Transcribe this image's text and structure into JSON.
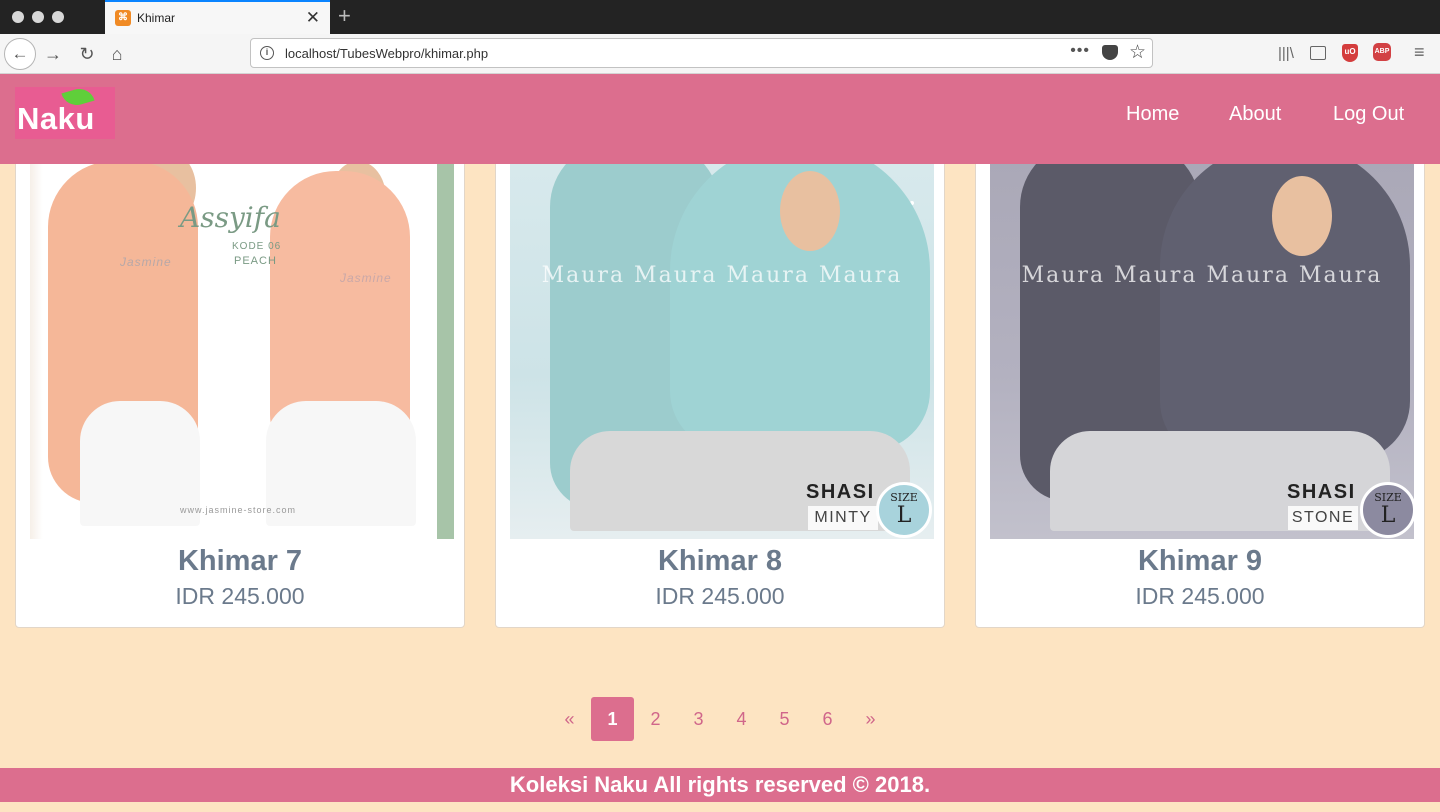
{
  "browser": {
    "tab_title": "Khimar",
    "new_tab": "+",
    "url": "localhost/TubesWebpro/khimar.php",
    "icons": [
      "back-icon",
      "forward-icon",
      "reload-icon",
      "home-icon",
      "info-icon",
      "more-icon",
      "pocket-icon",
      "bookmark-star-icon",
      "library-icon",
      "sidebar-icon",
      "ublock-icon",
      "adblock-icon",
      "menu-icon"
    ],
    "extension_labels": {
      "ublock": "uO",
      "abp": "ABP"
    }
  },
  "site": {
    "logo": "Naku",
    "accent": "#dc6e8e",
    "background": "#fde4c2",
    "nav": [
      "Home",
      "About",
      "Log Out"
    ]
  },
  "products": [
    {
      "name": "Khimar 7",
      "price": "IDR 245.000",
      "image": {
        "brand": "Assyifa",
        "code": "KODE 06",
        "color": "PEACH",
        "watermark": "Jasmine",
        "site": "www.jasmine-store.com",
        "scarf_color": "#f5b798"
      }
    },
    {
      "name": "Khimar 8",
      "price": "IDR 245.000",
      "image": {
        "watermark": "Maura Maura Maura Maura",
        "model": "SHASI",
        "color": "MINTY",
        "size_label": "SIZE",
        "size": "L",
        "scarf_color": "#9ccccd"
      }
    },
    {
      "name": "Khimar 9",
      "price": "IDR 245.000",
      "image": {
        "watermark": "Maura Maura Maura Maura",
        "model": "SHASI",
        "color": "STONE",
        "size_label": "SIZE",
        "size": "L",
        "scarf_color": "#5b5a68"
      }
    }
  ],
  "pagination": {
    "prev": "«",
    "pages": [
      "1",
      "2",
      "3",
      "4",
      "5",
      "6"
    ],
    "next": "»",
    "current": "1"
  },
  "footer": {
    "text": "Koleksi Naku All rights reserved © 2018."
  }
}
